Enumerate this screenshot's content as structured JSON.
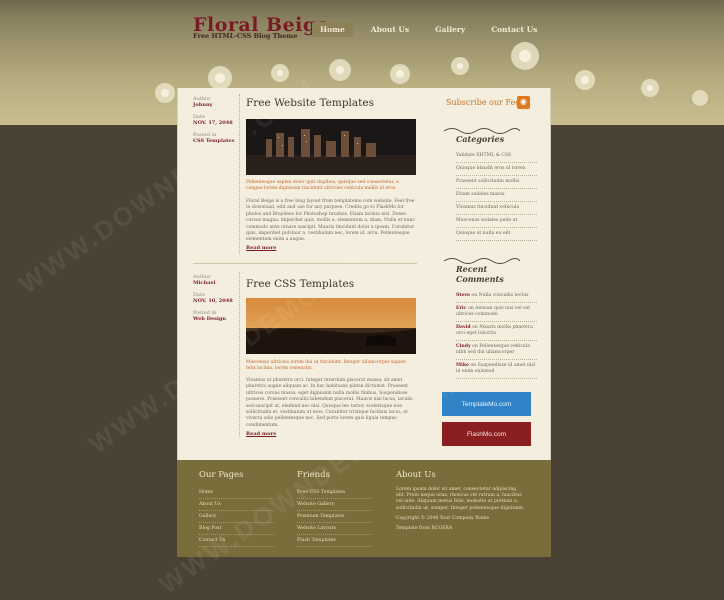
{
  "header": {
    "title": "Floral Beige",
    "subtitle": "Free HTML-CSS Blog Theme",
    "nav": [
      "Home",
      "About Us",
      "Gallery",
      "Contact Us"
    ],
    "active_nav": "Home"
  },
  "posts": [
    {
      "author_label": "Author",
      "author": "Johnny",
      "date_label": "Date",
      "date": "NOV. 17, 2048",
      "posted_label": "Posted in",
      "category": "CSS Templates",
      "title": "Free Website Templates",
      "orange_text": "Pellentesque sapien dolor quis dapibus, quisque sed consectetur, a congue lorem dignissim tincidunt ultricies vehicula mollis id eros.",
      "body": "Floral Beige is a free blog layout from templatemo.com website. Feel free to download, edit and use for any purpose. Credits go to FlashMo for photos and Braydens for Photoshop brushes. Etiam lacinia nisi. Donec cursus magna, imperdiet quis, mollis a, elementum a, diam. Nulla et nunc commodo ante ornare suscipit. Mauris tincidunt dolor a ipsum. Curabitur quis, imperdiet pulvinar a, vestibulum nec, lorem id, arcu. Pellentesque elementum enim a augue.",
      "read_more": "Read more"
    },
    {
      "author_label": "Author",
      "author": "Michael",
      "date_label": "Date",
      "date": "NOV. 10, 2048",
      "posted_label": "Posted in",
      "category": "Web Design",
      "title": "Free CSS Templates",
      "orange_text": "Maecenas ultricies lorem dui ut tincidunt. Integer ullamcorper sapien felis lacinia, lorem venenatis.",
      "body": "Vivamus ut pharetra orci. Integer interdum placerat massa, sit amet pharetra augue aliquam ac. In hac habitasse platea dictumst. Praesent ultrices cursus massa, eget dignissim nulla mollis finibus. Suspendisse posuere. Praesent convallis bibendum placerat. Mauris nisi lacus, iaculis sed suscipit ut, eleifend nec nisi. Quisque leo tortor, scelerisque non sollicitudin et, vestibulum ut eros. Curabitur tristique facilisis lacus, et viverra odio pellentesque nec. Sed porta lorem quis ligula tempus condimentum.",
      "read_more": "Read more"
    }
  ],
  "sidebar": {
    "feed": "Subscribe our Feed",
    "categories_title": "Categories",
    "categories": [
      "Validate XHTML & CSS",
      "Quisque blandit eros id lorem",
      "Praesent sollicitudin mollis",
      "Etiam sodales massa",
      "Vivamus tincidunt vehicula",
      "Maecenas sodales pede ut",
      "Quisque at nulla eu elit"
    ],
    "comments_title": "Recent Comments",
    "comments": [
      {
        "name": "Steve",
        "text": "on Nulla convallis lectus"
      },
      {
        "name": "Eric",
        "text": "on Aenean quis nisi vel est ultrices commodo"
      },
      {
        "name": "David",
        "text": "on Mauris mollis pharetra orci eget lobortis"
      },
      {
        "name": "Cindy",
        "text": "on Pellentesque vehicula nibh sed dui ullamcorper"
      },
      {
        "name": "Mike",
        "text": "on Suspendisse id amet nisl id enim euismod"
      }
    ],
    "btn_templatemo": "TemplateMo.com",
    "btn_flashmo": "FlashMo.com"
  },
  "footer": {
    "pages_title": "Our Pages",
    "pages": [
      "Home",
      "About Us",
      "Gallery",
      "Blog Post",
      "Contact Us"
    ],
    "friends_title": "Friends",
    "friends": [
      "Free CSS Templates",
      "Website Gallery",
      "Premium Templates",
      "Website Layouts",
      "Flash Templates"
    ],
    "about_title": "About Us",
    "about_text": "Lorem ipsum dolor sit amet, consectetur adipiscing elit. Proin neque urna, rhoncus vel rutrum a, faucibus vel ante. Aliquam metus felis, molestie ut pretium a, sollicitudin ut, semper. Integer pellentesque dignissim.",
    "copyright": "Copyright © 2048 Your Company Name",
    "credit": "Template from BCGERA"
  },
  "watermark": "WWW.DOWNDEMO.COM"
}
